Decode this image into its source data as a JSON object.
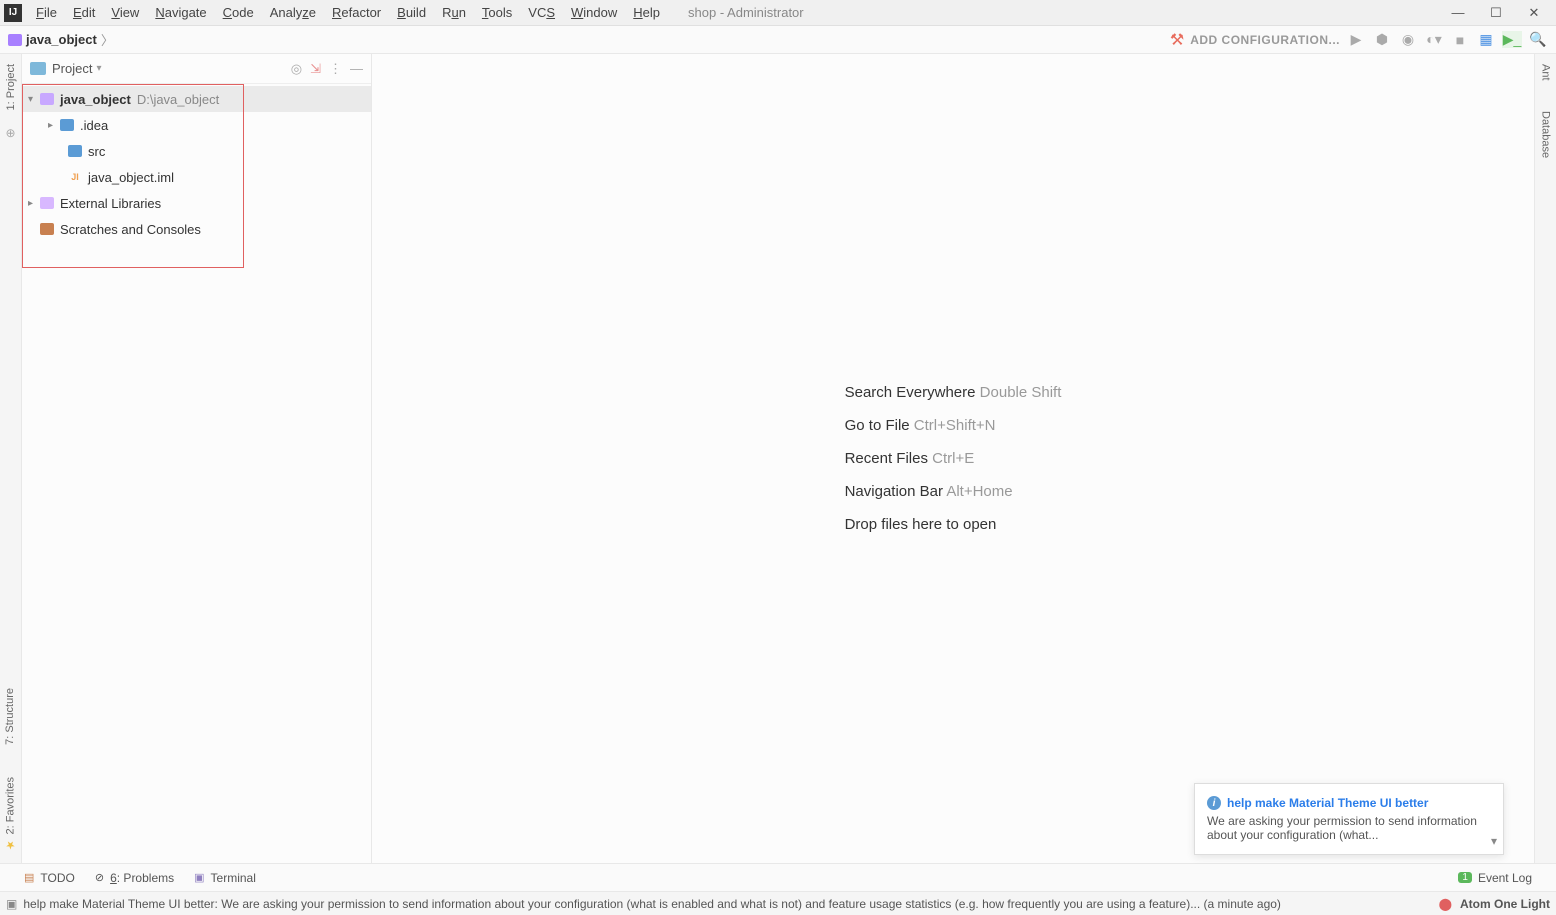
{
  "menu": {
    "items": [
      "File",
      "Edit",
      "View",
      "Navigate",
      "Code",
      "Analyze",
      "Refactor",
      "Build",
      "Run",
      "Tools",
      "VCS",
      "Window",
      "Help"
    ],
    "title": "shop - Administrator"
  },
  "navbar": {
    "breadcrumb": "java_object",
    "add_config": "ADD CONFIGURATION..."
  },
  "project_panel": {
    "title": "Project",
    "tree": {
      "root": {
        "name": "java_object",
        "path": "D:\\java_object"
      },
      "idea": ".idea",
      "src": "src",
      "iml": "java_object.iml",
      "external": "External Libraries",
      "scratches": "Scratches and Consoles"
    }
  },
  "welcome": {
    "search_label": "Search Everywhere",
    "search_key": "Double Shift",
    "goto_label": "Go to File",
    "goto_key": "Ctrl+Shift+N",
    "recent_label": "Recent Files",
    "recent_key": "Ctrl+E",
    "nav_label": "Navigation Bar",
    "nav_key": "Alt+Home",
    "drop": "Drop files here to open"
  },
  "right_stripe": {
    "ant": "Ant",
    "database": "Database"
  },
  "left_stripe": {
    "project": "1: Project",
    "structure": "7: Structure",
    "favorites": "2: Favorites"
  },
  "notification": {
    "title": "help make Material Theme UI better",
    "body": "We are asking your permission to send information about your configuration (what..."
  },
  "bottom_panel": {
    "todo": "TODO",
    "problems": "6: Problems",
    "terminal": "Terminal",
    "event_log": "Event Log",
    "event_badge": "1"
  },
  "statusbar": {
    "msg": "help make Material Theme UI better: We are asking your permission to send information about your configuration (what is enabled and what is not) and feature usage statistics (e.g. how frequently you are using a feature)... (a minute ago)",
    "theme": "Atom One Light"
  }
}
